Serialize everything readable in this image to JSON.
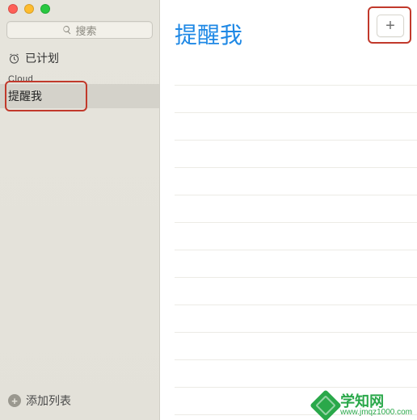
{
  "sidebar": {
    "search": {
      "placeholder": "搜索"
    },
    "smart": {
      "scheduled": "已计划"
    },
    "group": {
      "label": "Cloud"
    },
    "lists": [
      {
        "name": "提醒我"
      }
    ],
    "add_list": "添加列表"
  },
  "main": {
    "title": "提醒我",
    "add_button": "+"
  },
  "watermark": {
    "title": "学知网",
    "url": "www.jmqz1000.com"
  },
  "colors": {
    "accent": "#1e88e5",
    "highlight": "#c1392b"
  }
}
